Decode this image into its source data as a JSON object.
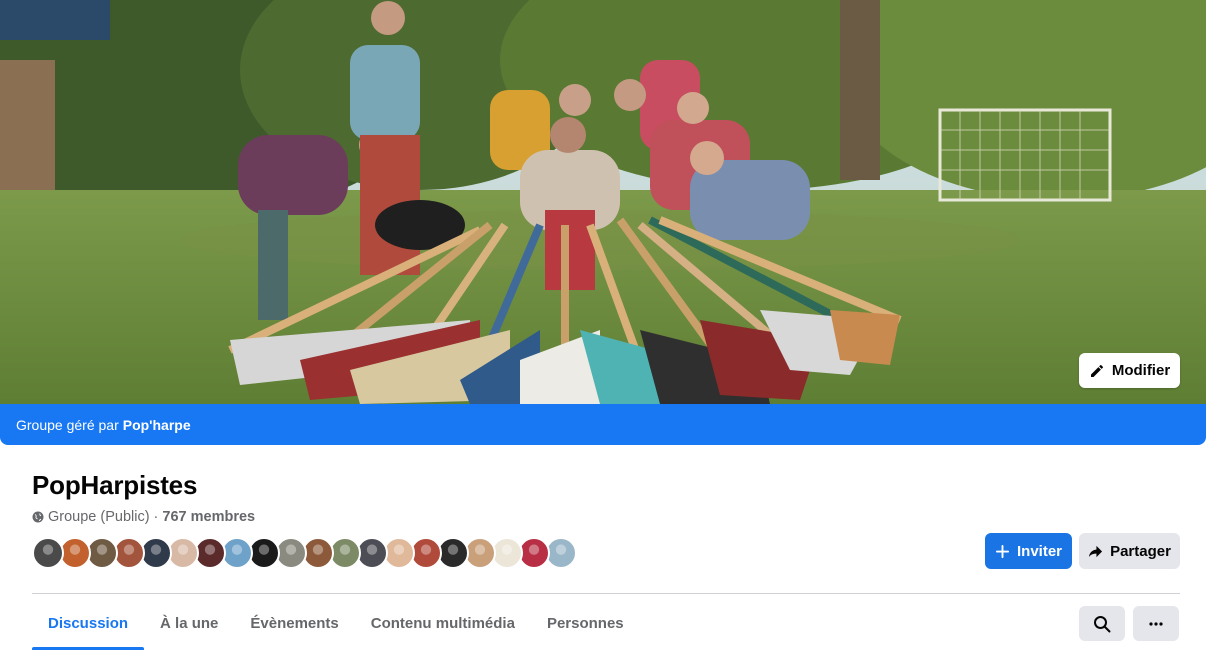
{
  "cover": {
    "edit_label": "Modifier"
  },
  "banner": {
    "prefix": "Groupe géré par",
    "manager": "Pop'harpe"
  },
  "group": {
    "name": "PopHarpistes",
    "privacy": "Groupe (Public)",
    "separator": "·",
    "members": "767 membres"
  },
  "member_avatars": [
    {
      "color": "#4a4a4a"
    },
    {
      "color": "#c2612d"
    },
    {
      "color": "#6f5a44"
    },
    {
      "color": "#a3543c"
    },
    {
      "color": "#2f3a4a"
    },
    {
      "color": "#d8b9a6"
    },
    {
      "color": "#5b2a2a"
    },
    {
      "color": "#6fa2c9"
    },
    {
      "color": "#1a1a1a"
    },
    {
      "color": "#8a8a80"
    },
    {
      "color": "#8c5a3a"
    },
    {
      "color": "#7d8a66"
    },
    {
      "color": "#4d4d55"
    },
    {
      "color": "#e0b89a"
    },
    {
      "color": "#b04a3a"
    },
    {
      "color": "#2a2a2a"
    },
    {
      "color": "#c9a07a"
    },
    {
      "color": "#ece6d8"
    },
    {
      "color": "#b82f45"
    },
    {
      "color": "#9ab7c9"
    }
  ],
  "actions": {
    "invite_label": "Inviter",
    "share_label": "Partager"
  },
  "tabs": [
    {
      "label": "Discussion",
      "active": true
    },
    {
      "label": "À la une",
      "active": false
    },
    {
      "label": "Évènements",
      "active": false
    },
    {
      "label": "Contenu multimédia",
      "active": false
    },
    {
      "label": "Personnes",
      "active": false
    }
  ],
  "colors": {
    "brand": "#1877f2",
    "secondary_text": "#65676b"
  },
  "icons": [
    "pencil-icon",
    "globe-icon",
    "plus-icon",
    "share-arrow-icon",
    "search-icon",
    "more-dots-icon"
  ]
}
